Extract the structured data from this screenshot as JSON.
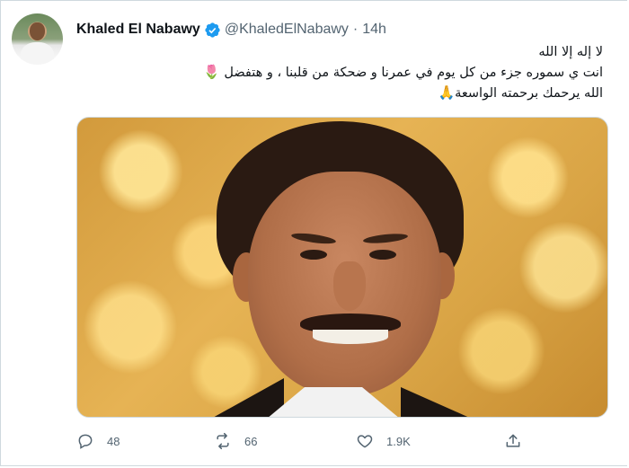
{
  "tweet": {
    "author_name": "Khaled El Nabawy",
    "handle": "@KhaledElNabawy",
    "separator": "·",
    "time": "14h",
    "text_lines": [
      "لا إله إلا الله",
      "انت ي سموره جزء من كل يوم في عمرنا و ضحكة من قلبنا ، و هتفضل",
      "الله يرحمك برحمته الواسعة"
    ],
    "line2_emoji": "🌷",
    "line3_emoji": "🙏"
  },
  "actions": {
    "reply_count": "48",
    "retweet_count": "66",
    "like_count": "1.9K"
  },
  "icons": {
    "verified": "verified-badge-icon",
    "reply": "reply-icon",
    "retweet": "retweet-icon",
    "like": "heart-icon",
    "share": "share-icon"
  },
  "colors": {
    "verified_blue": "#1d9bf0",
    "secondary_text": "#536471",
    "border": "#cfd9de"
  }
}
